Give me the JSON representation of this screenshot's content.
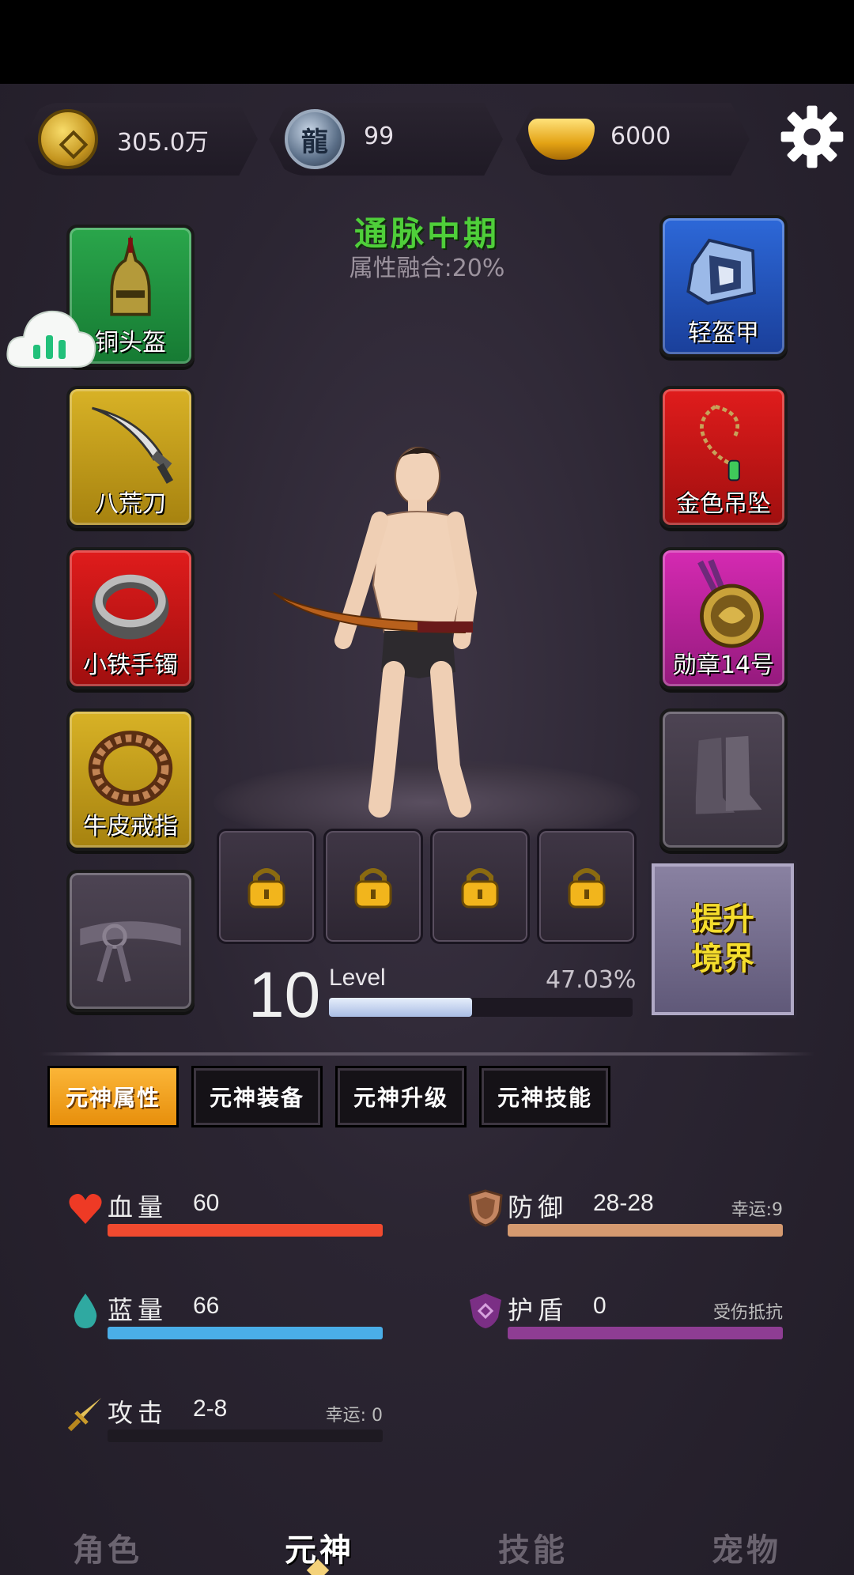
{
  "currency": {
    "coins": "305.0万",
    "dragon_tokens": "99",
    "gold_ingots": "6000"
  },
  "realm": {
    "title": "通脉中期",
    "fusion": "属性融合:20%"
  },
  "equipment": {
    "left": [
      {
        "label": "铜头盔",
        "color": "#1f9340"
      },
      {
        "label": "八荒刀",
        "color": "#c9a31d"
      },
      {
        "label": "小铁手镯",
        "color": "#c91616"
      },
      {
        "label": "牛皮戒指",
        "color": "#c9a31d"
      },
      {
        "label": "",
        "color": "#463d4b"
      }
    ],
    "right": [
      {
        "label": "轻盔甲",
        "color": "#2555be"
      },
      {
        "label": "金色吊坠",
        "color": "#c91616"
      },
      {
        "label": "勋章14号",
        "color": "#bd24a0"
      },
      {
        "label": "",
        "color": "#463d4b"
      }
    ]
  },
  "upgrade_button": "提升境界",
  "level": {
    "value": "10",
    "label": "Level",
    "percent_text": "47.03%",
    "progress": 0.4703
  },
  "tabs": [
    "元神属性",
    "元神装备",
    "元神升级",
    "元神技能"
  ],
  "active_tab": 0,
  "stats": {
    "hp": {
      "name": "血量",
      "value": "60",
      "color": "#f04a2f"
    },
    "defense": {
      "name": "防御",
      "value": "28-28",
      "note": "幸运:9",
      "color": "#d59a70"
    },
    "mp": {
      "name": "蓝量",
      "value": "66",
      "color": "#4aaee8"
    },
    "shield": {
      "name": "护盾",
      "value": "0",
      "note": "受伤抵抗",
      "color": "#8e3d93"
    },
    "attack": {
      "name": "攻击",
      "value": "2-8",
      "note": "幸运: 0",
      "color": "#1e1a22"
    }
  },
  "bottom_nav": [
    "角色",
    "元神",
    "技能",
    "宠物"
  ],
  "active_nav": 1,
  "icons": {
    "settings": "gear-icon",
    "coin": "coin-icon",
    "dragon": "dragon-token-icon",
    "ingot": "gold-ingot-icon",
    "lock": "lock-icon",
    "heart": "heart-icon",
    "shield": "shield-icon",
    "drop": "water-drop-icon",
    "sword": "sword-icon",
    "cloud": "cloud-chart-icon"
  }
}
